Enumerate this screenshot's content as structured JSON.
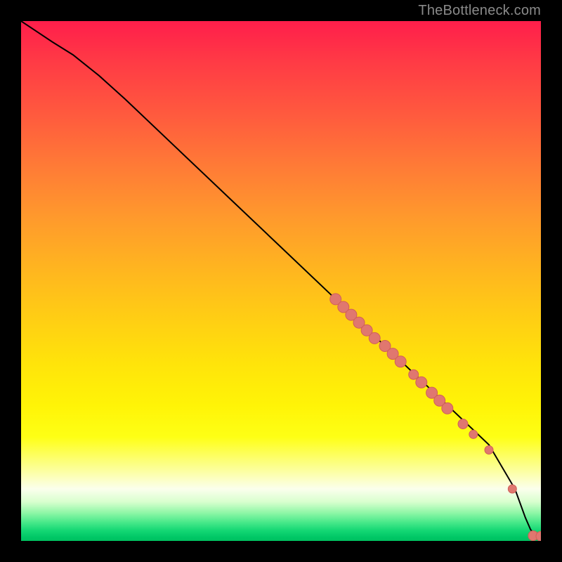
{
  "watermark": "TheBottleneck.com",
  "colors": {
    "background": "#000000",
    "curve": "#000000",
    "point_fill": "#e0776f",
    "point_stroke": "#d06058"
  },
  "chart_data": {
    "type": "line",
    "title": "",
    "xlabel": "",
    "ylabel": "",
    "xlim": [
      0,
      100
    ],
    "ylim": [
      0,
      100
    ],
    "series": [
      {
        "name": "curve",
        "x": [
          0,
          3,
          6,
          10,
          15,
          20,
          30,
          40,
          50,
          60,
          70,
          80,
          90,
          95,
          97,
          98,
          99,
          100
        ],
        "values": [
          100,
          98,
          96,
          93.5,
          89.5,
          85,
          75.5,
          66,
          56.5,
          47,
          37.5,
          28,
          18.5,
          10,
          4.5,
          2.2,
          1.0,
          0.8
        ]
      },
      {
        "name": "points",
        "kind": "scatter",
        "x": [
          60.5,
          62.0,
          63.5,
          65.0,
          66.5,
          68.0,
          70.0,
          71.5,
          73.0,
          75.5,
          77.0,
          79.0,
          80.5,
          82.0,
          85.0,
          87.0,
          90.0,
          94.5,
          98.5,
          100.0
        ],
        "values": [
          46.5,
          45.0,
          43.5,
          42.0,
          40.5,
          39.0,
          37.5,
          36.0,
          34.5,
          32.0,
          30.5,
          28.5,
          27.0,
          25.5,
          22.5,
          20.5,
          17.5,
          10.0,
          1.0,
          0.9
        ],
        "radius": [
          8,
          8,
          8,
          8,
          8,
          8,
          8,
          8,
          8,
          7,
          8,
          8,
          8,
          8,
          7,
          6,
          6,
          6,
          7,
          7
        ]
      }
    ]
  }
}
